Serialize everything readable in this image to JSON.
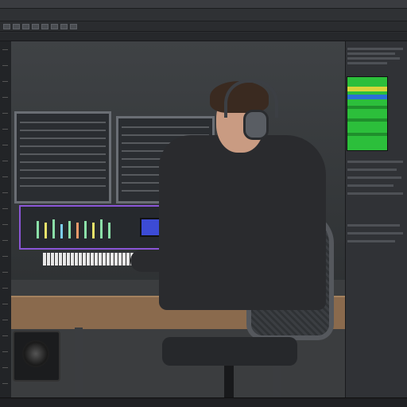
{
  "app": {
    "title": "",
    "menus": [
      "",
      "",
      "",
      "",
      "",
      "",
      "",
      "",
      "",
      ""
    ]
  },
  "status": {
    "text": ""
  },
  "colors": {
    "canvas_bg": "#3b3d3f",
    "panel_bg": "#303236",
    "preview_green": "#2cbf3b",
    "preview_yellow": "#d8d43a",
    "preview_blue": "#2a6fd6"
  },
  "icons": {
    "toolbar": [
      "move-tool-icon",
      "select-tool-icon",
      "crop-tool-icon",
      "brush-tool-icon",
      "eraser-tool-icon",
      "text-tool-icon",
      "zoom-tool-icon",
      "hand-tool-icon"
    ]
  },
  "canvas": {
    "subject": "image"
  }
}
